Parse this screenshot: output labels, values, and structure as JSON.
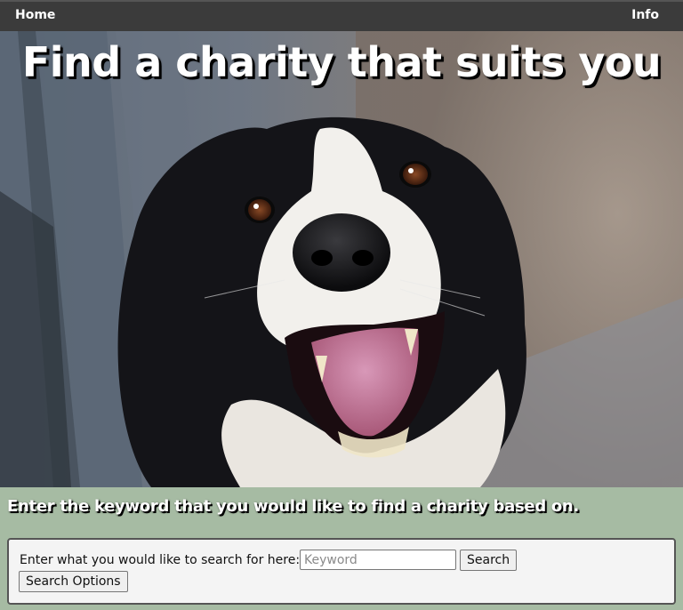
{
  "nav": {
    "home_label": "Home",
    "info_label": "Info"
  },
  "hero": {
    "title": "Find a charity that suits you",
    "image": "smiling-dog-photo"
  },
  "prompt": {
    "text": "Enter the keyword that you would like to find a charity based on."
  },
  "search": {
    "label": "Enter what you would like to search for here:",
    "input_value": "",
    "placeholder": "Keyword",
    "search_button": "Search",
    "options_button": "Search Options"
  },
  "colors": {
    "navbar": "#3b3b3b",
    "page_background": "#a6bba3",
    "search_panel": "#f4f4f4"
  }
}
